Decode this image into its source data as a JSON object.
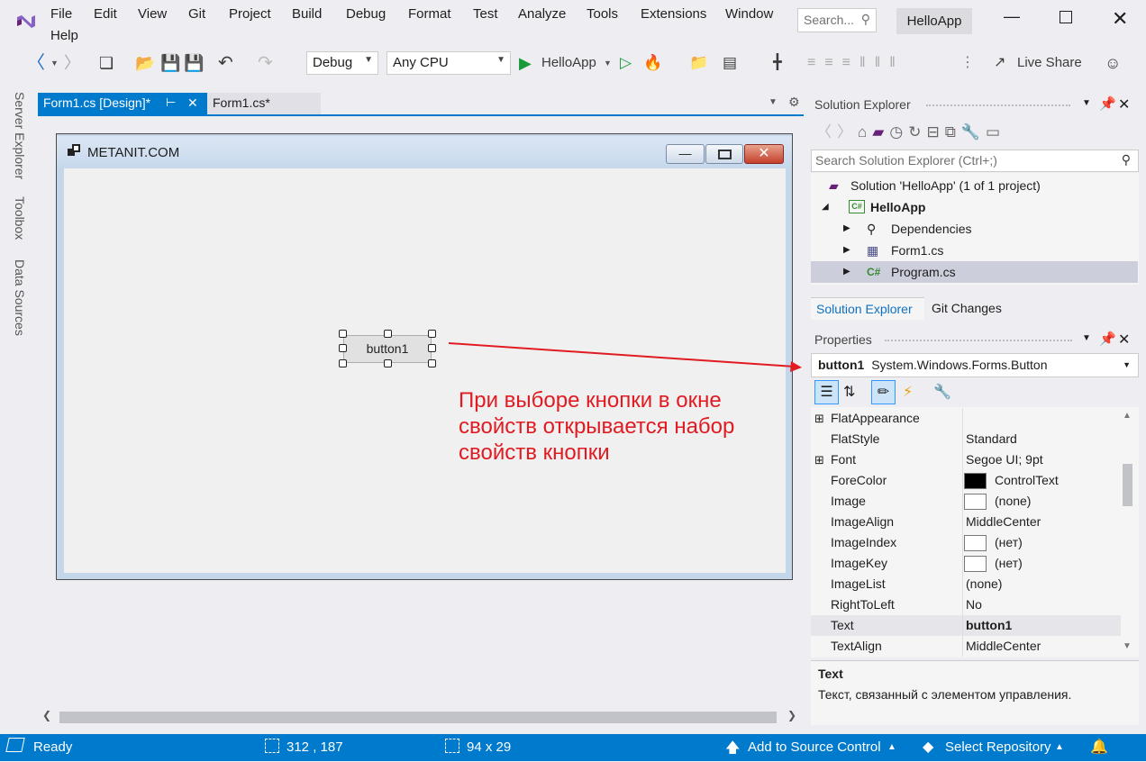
{
  "menu": {
    "items": [
      "File",
      "Edit",
      "View",
      "Git",
      "Project",
      "Build",
      "Debug",
      "Format",
      "Test",
      "Analyze",
      "Tools",
      "Extensions",
      "Window"
    ],
    "help": "Help",
    "search_placeholder": "Search...",
    "app_name": "HelloApp"
  },
  "toolbar": {
    "config": "Debug",
    "platform": "Any CPU",
    "run_label": "HelloApp",
    "live_share": "Live Share"
  },
  "left_rail": [
    "Server Explorer",
    "Toolbox",
    "Data Sources"
  ],
  "tabs": {
    "design": "Form1.cs [Design]*",
    "code": "Form1.cs*"
  },
  "form": {
    "caption": "METANIT.COM",
    "button_text": "button1"
  },
  "annotation": "При выборе кнопки в окне свойств открывается набор свойств кнопки",
  "solution_explorer": {
    "title": "Solution Explorer",
    "search_placeholder": "Search Solution Explorer (Ctrl+;)",
    "solution": "Solution 'HelloApp' (1 of 1 project)",
    "project": "HelloApp",
    "items": [
      "Dependencies",
      "Form1.cs",
      "Program.cs"
    ],
    "bottom_tabs": [
      "Solution Explorer",
      "Git Changes"
    ]
  },
  "properties": {
    "title": "Properties",
    "object_name": "button1",
    "object_type": "System.Windows.Forms.Button",
    "rows": [
      {
        "name": "FlatAppearance",
        "value": ""
      },
      {
        "name": "FlatStyle",
        "value": "Standard"
      },
      {
        "name": "Font",
        "value": "Segoe UI; 9pt"
      },
      {
        "name": "ForeColor",
        "value": "ControlText"
      },
      {
        "name": "Image",
        "value": "(none)"
      },
      {
        "name": "ImageAlign",
        "value": "MiddleCenter"
      },
      {
        "name": "ImageIndex",
        "value": "(нет)"
      },
      {
        "name": "ImageKey",
        "value": "(нет)"
      },
      {
        "name": "ImageList",
        "value": "(none)"
      },
      {
        "name": "RightToLeft",
        "value": "No"
      },
      {
        "name": "Text",
        "value": "button1"
      },
      {
        "name": "TextAlign",
        "value": "MiddleCenter"
      }
    ],
    "desc_title": "Text",
    "desc_text": "Текст, связанный с элементом управления."
  },
  "status": {
    "ready": "Ready",
    "position": "312 , 187",
    "size": "94 x 29",
    "source_control": "Add to Source Control",
    "repository": "Select Repository"
  },
  "colors": {
    "accent": "#007acc",
    "annotation": "#e01b22",
    "vs_purple": "#68217a"
  }
}
